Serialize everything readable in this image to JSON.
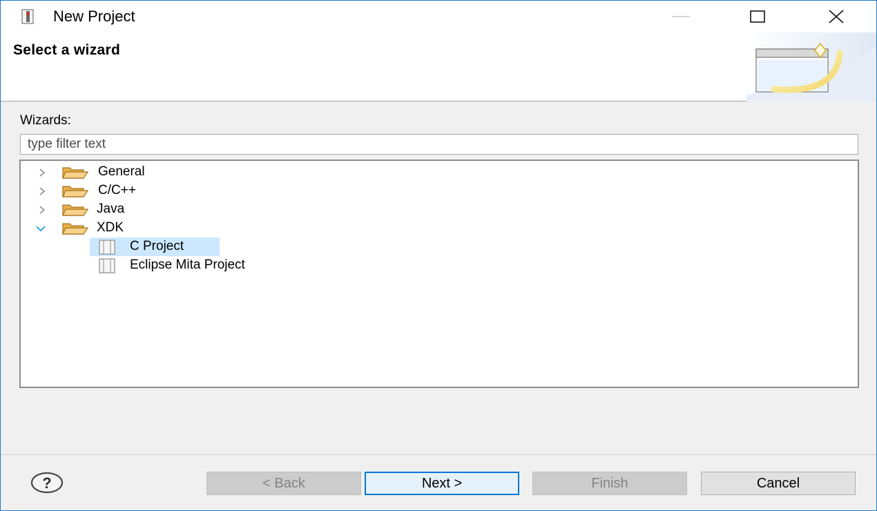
{
  "window": {
    "title": "New Project",
    "accent_color": "#1979ca"
  },
  "banner": {
    "title": "Select a wizard",
    "graphic_icon": "new-wizard-banner-icon"
  },
  "filter": {
    "label": "Wizards:",
    "placeholder": "type filter text",
    "value": ""
  },
  "tree": {
    "items": [
      {
        "label": "General",
        "expanded": false,
        "icon": "folder-icon"
      },
      {
        "label": "C/C++",
        "expanded": false,
        "icon": "folder-icon"
      },
      {
        "label": "Java",
        "expanded": false,
        "icon": "folder-icon"
      },
      {
        "label": "XDK",
        "expanded": true,
        "icon": "folder-icon",
        "children": [
          {
            "label": "C Project",
            "selected": true,
            "icon": "project-icon"
          },
          {
            "label": "Eclipse Mita Project",
            "selected": false,
            "icon": "project-icon"
          }
        ]
      }
    ],
    "selection_color": "#cce8ff"
  },
  "footer": {
    "help_icon": "help-icon",
    "back_label": "< Back",
    "next_label": "Next >",
    "finish_label": "Finish",
    "cancel_label": "Cancel"
  }
}
